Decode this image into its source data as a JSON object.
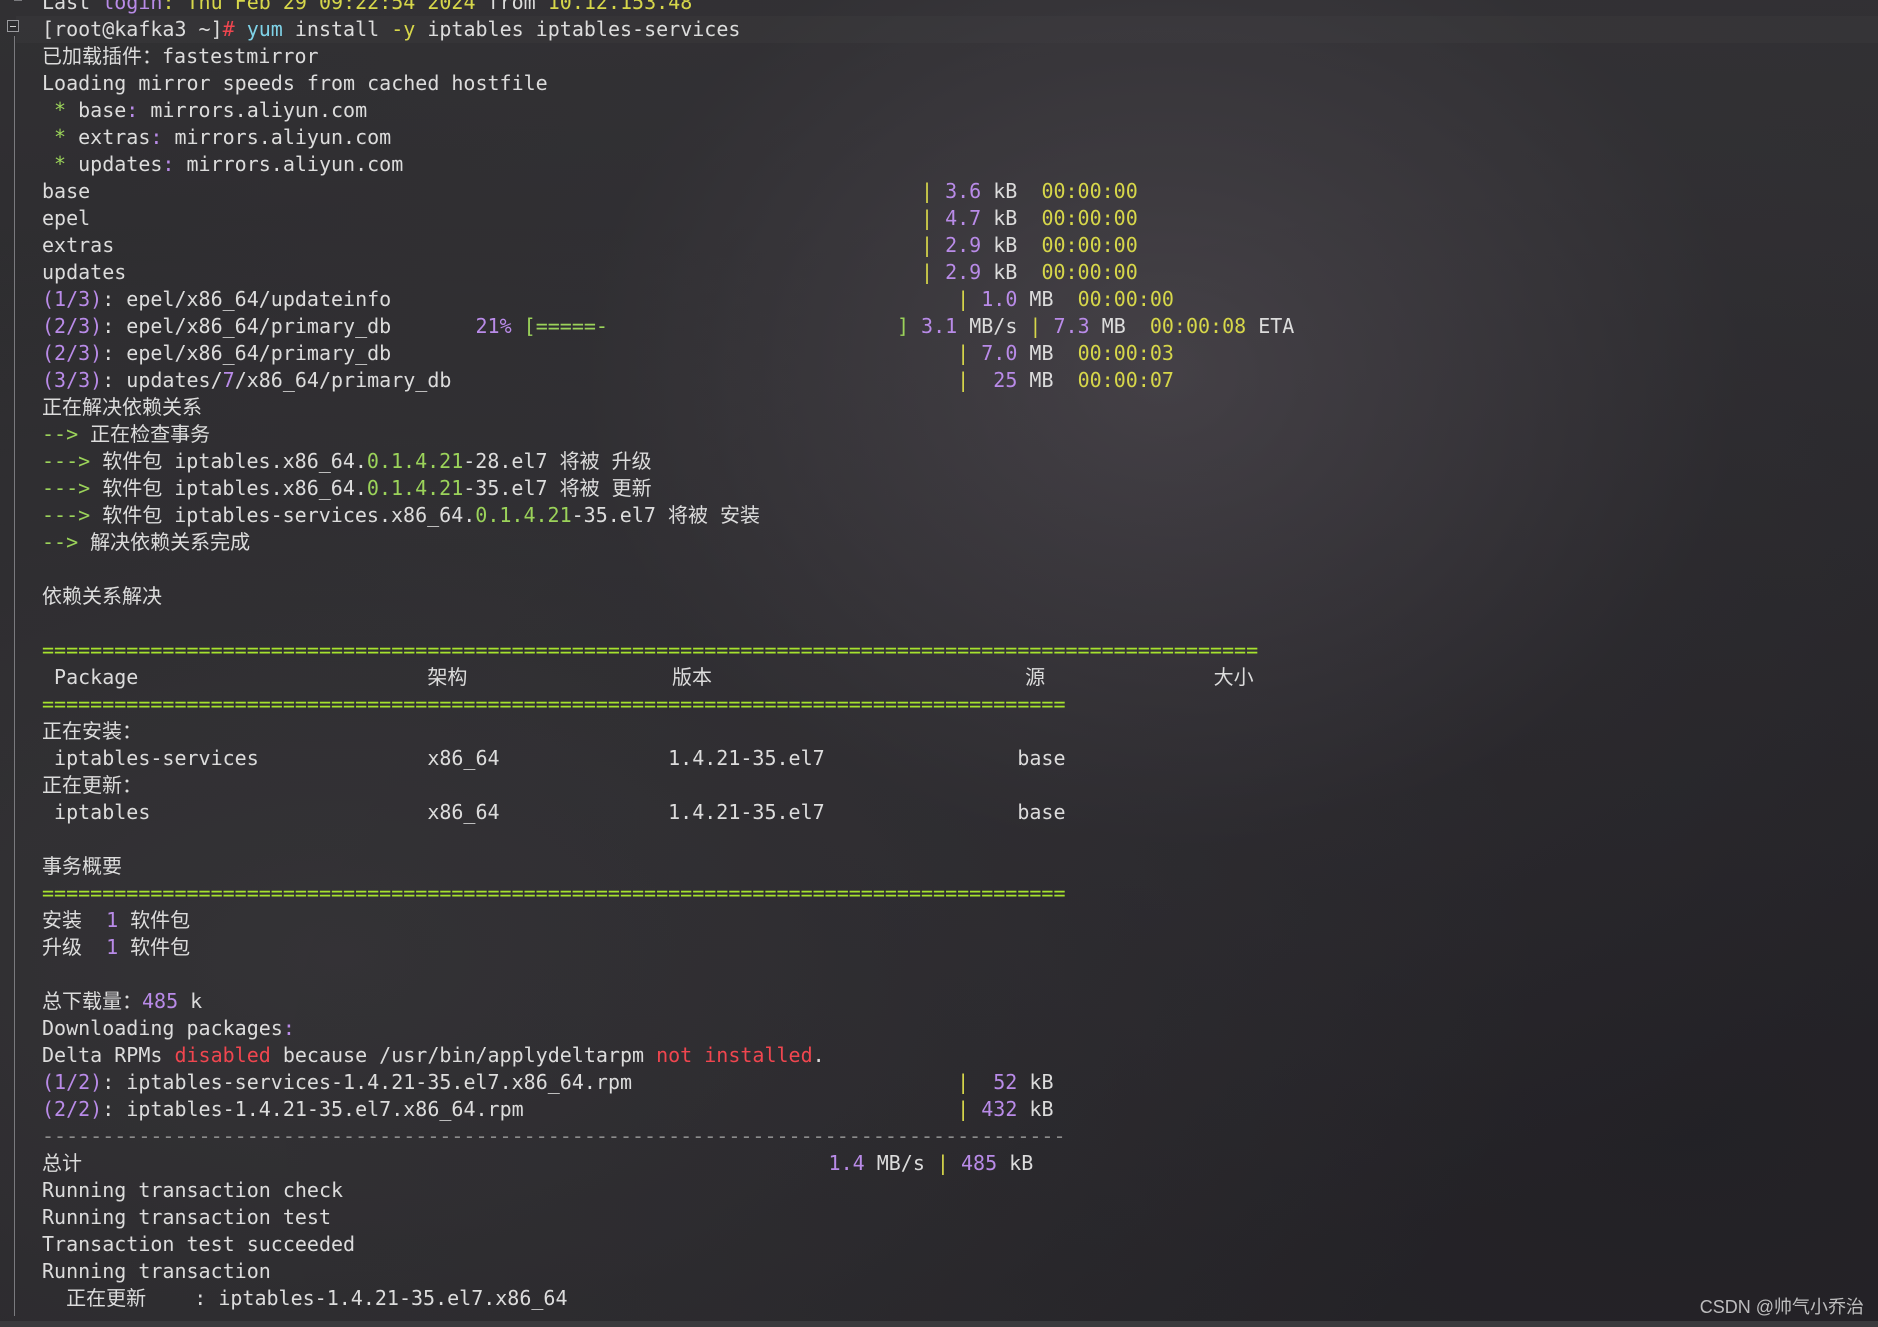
{
  "terminal": {
    "lines": [
      [
        {
          "t": "Last ",
          "c": ""
        },
        {
          "t": "login",
          "c": "c-pur"
        },
        {
          "t": ": Thu Feb ",
          "c": "c-yel"
        },
        {
          "t": "29 09:22:54 2024",
          "c": "c-yel"
        },
        {
          "t": " from ",
          "c": ""
        },
        {
          "t": "10.12.153.48",
          "c": "c-yel"
        }
      ],
      [
        {
          "t": "[root@kafka3 ~]",
          "c": ""
        },
        {
          "t": "# ",
          "c": "c-red"
        },
        {
          "t": "yum",
          "c": "c-cyan"
        },
        {
          "t": " install ",
          "c": ""
        },
        {
          "t": "-y",
          "c": "c-yel"
        },
        {
          "t": " iptables iptables-services",
          "c": ""
        }
      ],
      [
        {
          "t": "已加载插件：fastestmirror",
          "c": ""
        }
      ],
      [
        {
          "t": "Loading mirror speeds from cached hostfile",
          "c": ""
        }
      ],
      [
        {
          "t": " * ",
          "c": "c-grn"
        },
        {
          "t": "base",
          "c": ""
        },
        {
          "t": ": ",
          "c": "c-pur"
        },
        {
          "t": "mirrors.aliyun.com",
          "c": ""
        }
      ],
      [
        {
          "t": " * ",
          "c": "c-grn"
        },
        {
          "t": "extras",
          "c": ""
        },
        {
          "t": ": ",
          "c": "c-pur"
        },
        {
          "t": "mirrors.aliyun.com",
          "c": ""
        }
      ],
      [
        {
          "t": " * ",
          "c": "c-grn"
        },
        {
          "t": "updates",
          "c": ""
        },
        {
          "t": ": ",
          "c": "c-pur"
        },
        {
          "t": "mirrors.aliyun.com",
          "c": ""
        }
      ],
      [
        {
          "t": "base                                                                     ",
          "c": ""
        },
        {
          "t": "| ",
          "c": "c-yel"
        },
        {
          "t": "3.6",
          "c": "c-pur"
        },
        {
          "t": " kB  ",
          "c": ""
        },
        {
          "t": "00:00:00",
          "c": "c-yel"
        }
      ],
      [
        {
          "t": "epel                                                                     ",
          "c": ""
        },
        {
          "t": "| ",
          "c": "c-yel"
        },
        {
          "t": "4.7",
          "c": "c-pur"
        },
        {
          "t": " kB  ",
          "c": ""
        },
        {
          "t": "00:00:00",
          "c": "c-yel"
        }
      ],
      [
        {
          "t": "extras                                                                   ",
          "c": ""
        },
        {
          "t": "| ",
          "c": "c-yel"
        },
        {
          "t": "2.9",
          "c": "c-pur"
        },
        {
          "t": " kB  ",
          "c": ""
        },
        {
          "t": "00:00:00",
          "c": "c-yel"
        }
      ],
      [
        {
          "t": "updates                                                                  ",
          "c": ""
        },
        {
          "t": "| ",
          "c": "c-yel"
        },
        {
          "t": "2.9",
          "c": "c-pur"
        },
        {
          "t": " kB  ",
          "c": ""
        },
        {
          "t": "00:00:00",
          "c": "c-yel"
        }
      ],
      [
        {
          "t": "(1/3)",
          "c": "c-pur"
        },
        {
          "t": ": epel/x86_64/updateinfo                                               ",
          "c": ""
        },
        {
          "t": "| ",
          "c": "c-yel"
        },
        {
          "t": "1.0",
          "c": "c-pur"
        },
        {
          "t": " MB  ",
          "c": ""
        },
        {
          "t": "00:00:00",
          "c": "c-yel"
        }
      ],
      [
        {
          "t": "(2/3)",
          "c": "c-pur"
        },
        {
          "t": ": epel/x86_64/primary_db       ",
          "c": ""
        },
        {
          "t": "21%",
          "c": "c-pur"
        },
        {
          "t": " [=====-                        ] ",
          "c": "c-grn"
        },
        {
          "t": "3.1",
          "c": "c-pur"
        },
        {
          "t": " MB/s ",
          "c": ""
        },
        {
          "t": "| ",
          "c": "c-yel"
        },
        {
          "t": "7.3",
          "c": "c-pur"
        },
        {
          "t": " MB  ",
          "c": ""
        },
        {
          "t": "00:00:08",
          "c": "c-yel"
        },
        {
          "t": " ETA",
          "c": ""
        }
      ],
      [
        {
          "t": "(2/3)",
          "c": "c-pur"
        },
        {
          "t": ": epel/x86_64/primary_db                                               ",
          "c": ""
        },
        {
          "t": "| ",
          "c": "c-yel"
        },
        {
          "t": "7.0",
          "c": "c-pur"
        },
        {
          "t": " MB  ",
          "c": ""
        },
        {
          "t": "00:00:03",
          "c": "c-yel"
        }
      ],
      [
        {
          "t": "(3/3)",
          "c": "c-pur"
        },
        {
          "t": ": updates/",
          "c": ""
        },
        {
          "t": "7",
          "c": "c-pur"
        },
        {
          "t": "/x86_64/primary_db                                          ",
          "c": ""
        },
        {
          "t": "|  ",
          "c": "c-yel"
        },
        {
          "t": "25",
          "c": "c-pur"
        },
        {
          "t": " MB  ",
          "c": ""
        },
        {
          "t": "00:00:07",
          "c": "c-yel"
        }
      ],
      [
        {
          "t": "正在解决依赖关系",
          "c": ""
        }
      ],
      [
        {
          "t": "--> ",
          "c": "c-grn"
        },
        {
          "t": "正在检查事务",
          "c": ""
        }
      ],
      [
        {
          "t": "---> ",
          "c": "c-grn"
        },
        {
          "t": "软件包 iptables.x86_64.",
          "c": ""
        },
        {
          "t": "0.1.4.21",
          "c": "c-grn"
        },
        {
          "t": "-28.el7 将被 升级",
          "c": ""
        }
      ],
      [
        {
          "t": "---> ",
          "c": "c-grn"
        },
        {
          "t": "软件包 iptables.x86_64.",
          "c": ""
        },
        {
          "t": "0.1.4.21",
          "c": "c-grn"
        },
        {
          "t": "-35.el7 将被 更新",
          "c": ""
        }
      ],
      [
        {
          "t": "---> ",
          "c": "c-grn"
        },
        {
          "t": "软件包 iptables-services.x86_64.",
          "c": ""
        },
        {
          "t": "0.1.4.21",
          "c": "c-grn"
        },
        {
          "t": "-35.el7 将被 安装",
          "c": ""
        }
      ],
      [
        {
          "t": "--> ",
          "c": "c-grn"
        },
        {
          "t": "解决依赖关系完成",
          "c": ""
        }
      ],
      [
        {
          "t": "",
          "c": ""
        }
      ],
      [
        {
          "t": "依赖关系解决",
          "c": ""
        }
      ],
      [
        {
          "t": "",
          "c": ""
        }
      ],
      [
        {
          "t": "=====================================================================================================",
          "c": "sep-g"
        }
      ],
      [
        {
          "t": " Package                        架构                 版本                          源              大小",
          "c": ""
        }
      ],
      [
        {
          "t": "=====================================================================================",
          "c": "sep-g"
        }
      ],
      [
        {
          "t": "正在安装：",
          "c": ""
        }
      ],
      [
        {
          "t": " iptables-services              x86_64              1.4.21-35.el7                base",
          "c": ""
        }
      ],
      [
        {
          "t": "正在更新：",
          "c": ""
        }
      ],
      [
        {
          "t": " iptables                       x86_64              1.4.21-35.el7                base",
          "c": ""
        }
      ],
      [
        {
          "t": "",
          "c": ""
        }
      ],
      [
        {
          "t": "事务概要",
          "c": ""
        }
      ],
      [
        {
          "t": "=====================================================================================",
          "c": "sep-g"
        }
      ],
      [
        {
          "t": "安装  ",
          "c": ""
        },
        {
          "t": "1",
          "c": "c-pur"
        },
        {
          "t": " 软件包",
          "c": ""
        }
      ],
      [
        {
          "t": "升级  ",
          "c": ""
        },
        {
          "t": "1",
          "c": "c-pur"
        },
        {
          "t": " 软件包",
          "c": ""
        }
      ],
      [
        {
          "t": "",
          "c": ""
        }
      ],
      [
        {
          "t": "总下载量：",
          "c": ""
        },
        {
          "t": "485",
          "c": "c-pur"
        },
        {
          "t": " k",
          "c": ""
        }
      ],
      [
        {
          "t": "Downloading packages",
          "c": ""
        },
        {
          "t": ":",
          "c": "c-pur"
        }
      ],
      [
        {
          "t": "Delta RPMs ",
          "c": ""
        },
        {
          "t": "disabled",
          "c": "c-red"
        },
        {
          "t": " because /usr/bin/applydeltarpm ",
          "c": ""
        },
        {
          "t": "not installed",
          "c": "c-red"
        },
        {
          "t": ".",
          "c": ""
        }
      ],
      [
        {
          "t": "(1/2)",
          "c": "c-pur"
        },
        {
          "t": ": iptables-services-1.4.21-35.el7.x86_64.rpm                           ",
          "c": ""
        },
        {
          "t": "|  ",
          "c": "c-yel"
        },
        {
          "t": "52",
          "c": "c-pur"
        },
        {
          "t": " kB",
          "c": ""
        }
      ],
      [
        {
          "t": "(2/2)",
          "c": "c-pur"
        },
        {
          "t": ": iptables-1.4.21-35.el7.x86_64.rpm                                    ",
          "c": ""
        },
        {
          "t": "| ",
          "c": "c-yel"
        },
        {
          "t": "432",
          "c": "c-pur"
        },
        {
          "t": " kB",
          "c": ""
        }
      ],
      [
        {
          "t": "-------------------------------------------------------------------------------------",
          "c": "sep-gray"
        }
      ],
      [
        {
          "t": "总计                                                              ",
          "c": ""
        },
        {
          "t": "1.4",
          "c": "c-pur"
        },
        {
          "t": " MB/s ",
          "c": ""
        },
        {
          "t": "| ",
          "c": "c-yel"
        },
        {
          "t": "485",
          "c": "c-pur"
        },
        {
          "t": " kB",
          "c": ""
        }
      ],
      [
        {
          "t": "Running transaction check",
          "c": ""
        }
      ],
      [
        {
          "t": "Running transaction test",
          "c": ""
        }
      ],
      [
        {
          "t": "Transaction test succeeded",
          "c": ""
        }
      ],
      [
        {
          "t": "Running transaction",
          "c": ""
        }
      ],
      [
        {
          "t": "  正在更新    : iptables-1.4.21-35.el7.x86_64",
          "c": ""
        }
      ]
    ]
  },
  "watermark": "CSDN @帅气小乔治",
  "colors": {
    "purple": "#b98be8",
    "yellow": "#d7d74a",
    "green": "#9bd35a",
    "red": "#f0464f",
    "cyan": "#7fd3e8"
  }
}
